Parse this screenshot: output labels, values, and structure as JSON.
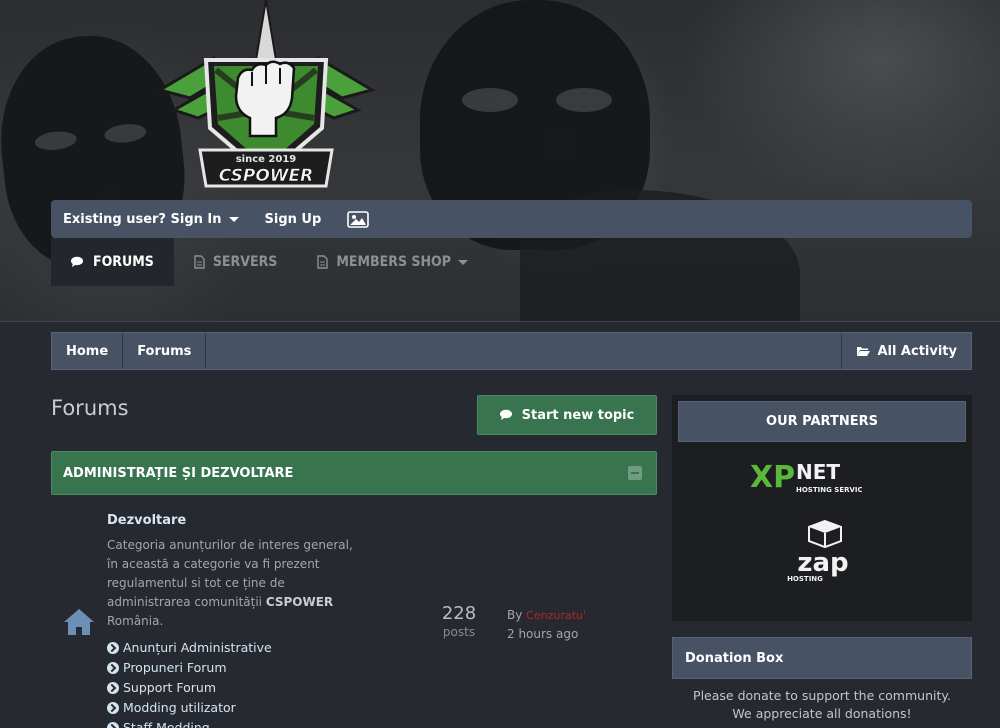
{
  "site": {
    "logo_text_small": "since 2019",
    "logo_text_main": "CSPOWER"
  },
  "userbar": {
    "sign_in": "Existing user? Sign In",
    "sign_up": "Sign Up"
  },
  "nav": {
    "tabs": [
      {
        "label": "FORUMS",
        "icon": "comments-icon",
        "active": true
      },
      {
        "label": "SERVERS",
        "icon": "document-icon",
        "active": false
      },
      {
        "label": "MEMBERS SHOP",
        "icon": "document-icon",
        "active": false
      }
    ]
  },
  "breadcrumb": {
    "items": [
      "Home",
      "Forums"
    ],
    "all_activity": "All Activity"
  },
  "main": {
    "title": "Forums",
    "new_topic": "Start new topic",
    "category": {
      "title": "ADMINISTRAȚIE ȘI DEZVOLTARE",
      "forum": {
        "title": "Dezvoltare",
        "description_pre": "Categoria anunțurilor de interes general, în această a categorie va fi prezent regulamentul si tot ce ține de administrarea comunității ",
        "description_bold": "CSPOWER",
        "description_post": "România.",
        "subforums": [
          "Anunțuri Administrative",
          "Propuneri Forum",
          "Support Forum",
          "Modding utilizator",
          "Staff Modding"
        ],
        "posts_count": "228",
        "posts_label": "posts",
        "last_post_by": "By",
        "last_post_user": "Cenzuratu'",
        "last_post_time": "2 hours ago"
      }
    }
  },
  "sidebar": {
    "partners_title": "OUR PARTNERS",
    "partner1_a": "XP",
    "partner1_b": "NET",
    "partner1_sub": "HOSTING SERVICES",
    "partner2_a": "zap",
    "partner2_sub": "HOSTING",
    "donation_title": "Donation Box",
    "donation_line1": "Please donate to support the community.",
    "donation_line2": "We appreciate all donations!"
  },
  "colors": {
    "accent_green": "#38744e",
    "bar_blue": "#475264",
    "background": "#262a30",
    "username_red": "#b3242a"
  }
}
